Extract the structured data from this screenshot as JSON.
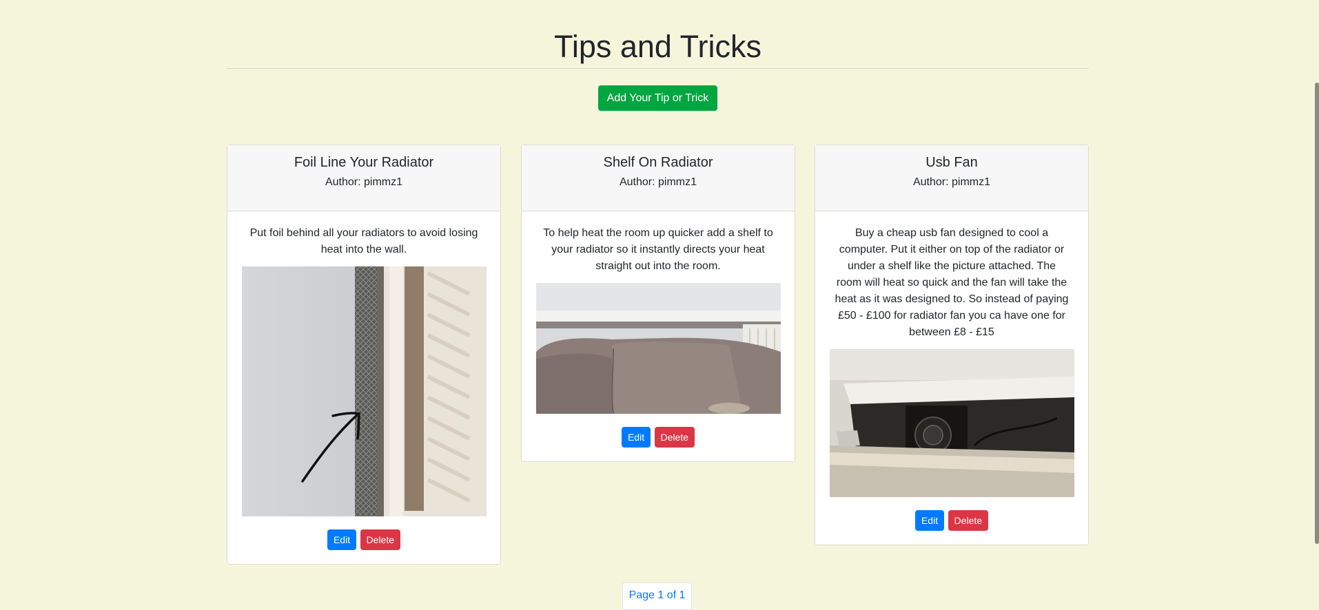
{
  "page": {
    "title": "Tips and Tricks",
    "add_button_label": "Add Your Tip or Trick",
    "pagination_label": "Page 1 of 1"
  },
  "cards": [
    {
      "title": "Foil Line Your Radiator",
      "author": "Author: pimmz1",
      "text": "Put foil behind all your radiators to avoid losing heat into the wall.",
      "edit_label": "Edit",
      "delete_label": "Delete"
    },
    {
      "title": "Shelf On Radiator",
      "author": "Author: pimmz1",
      "text": "To help heat the room up quicker add a shelf to your radiator so it instantly directs your heat straight out into the room.",
      "edit_label": "Edit",
      "delete_label": "Delete"
    },
    {
      "title": "Usb Fan",
      "author": "Author: pimmz1",
      "text": "Buy a cheap usb fan designed to cool a computer. Put it either on top of the radiator or under a shelf like the picture attached. The room will heat so quick and the fan will take the heat as it was designed to. So instead of paying £50 - £100 for radiator fan you ca have one for between £8 - £15",
      "edit_label": "Edit",
      "delete_label": "Delete"
    }
  ],
  "colors": {
    "background": "#f5f5dc",
    "add_button": "#00a640",
    "edit_button": "#007bff",
    "delete_button": "#dc3545"
  }
}
